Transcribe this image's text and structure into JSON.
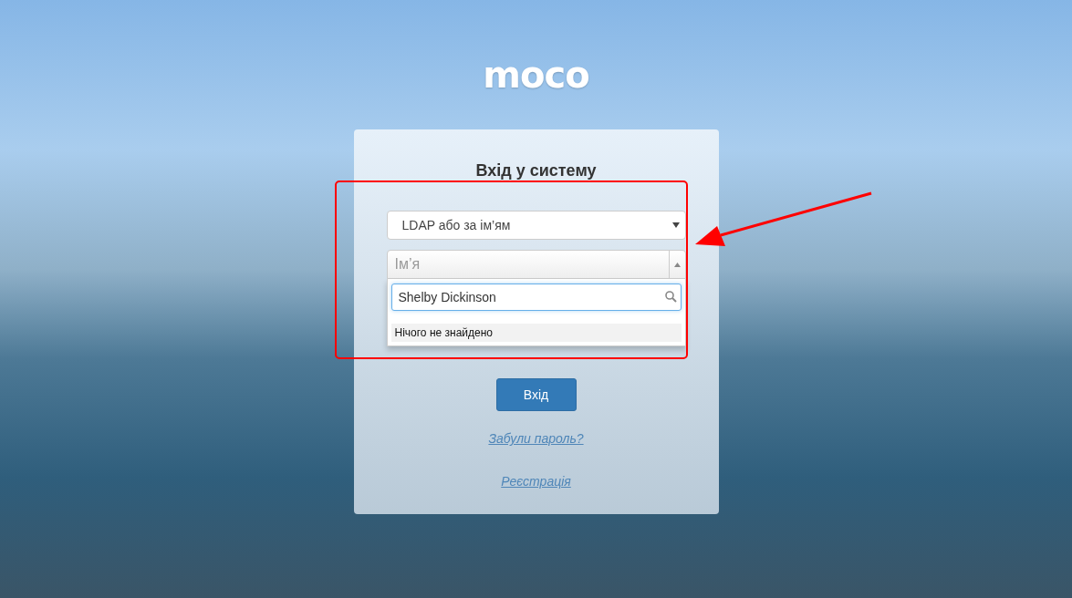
{
  "logo": "moco",
  "login_form": {
    "title": "Вхід у систему",
    "login_type": {
      "value": "LDAP або за ім’ям"
    },
    "name_select": {
      "placeholder": "Ім’я",
      "expanded": true,
      "search_value": "Shelby Dickinson",
      "no_results": "Нічого не знайдено"
    },
    "submit_button": "Вхід",
    "links": [
      "Забули пароль?",
      "Реєстрація"
    ]
  }
}
